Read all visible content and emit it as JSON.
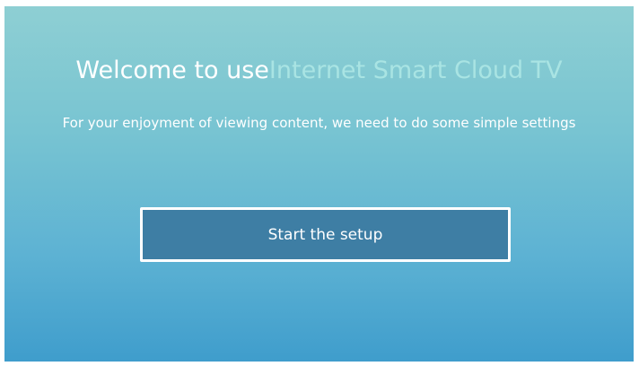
{
  "welcome": {
    "title_prefix": "Welcome to use",
    "title_brand": "Internet Smart Cloud TV",
    "subtitle": "For your enjoyment of viewing content, we need to do some simple settings"
  },
  "actions": {
    "start_label": "Start the setup"
  },
  "colors": {
    "background_top": "#8ecfd3",
    "background_bottom": "#3f9dcc",
    "button_fill": "#3e7ea4",
    "brand_text": "#a9e4e3"
  }
}
